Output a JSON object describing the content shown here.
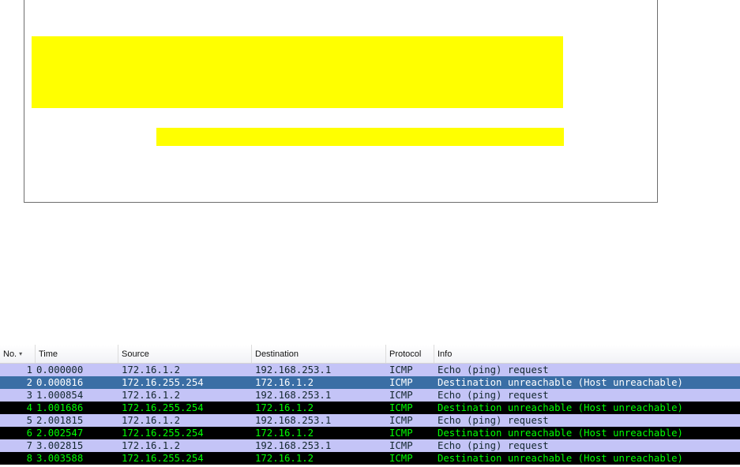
{
  "packet_list": {
    "columns": {
      "no": "No.",
      "time": "Time",
      "source": "Source",
      "destination": "Destination",
      "protocol": "Protocol",
      "info": "Info"
    },
    "sort_icon": "sort-descending-icon",
    "colors": {
      "request_bg": "#c4c4f7",
      "request_fg": "#12272e",
      "unreachable_bg": "#000000",
      "unreachable_fg": "#00ff00",
      "selected_bg": "#3a6ea5",
      "selected_fg": "#ffffff",
      "highlight": "#ffff00"
    },
    "rows": [
      {
        "no": "1",
        "time": "0.000000",
        "source": "172.16.1.2",
        "destination": "192.168.253.1",
        "protocol": "ICMP",
        "info": "Echo (ping) request",
        "kind": "request"
      },
      {
        "no": "2",
        "time": "0.000816",
        "source": "172.16.255.254",
        "destination": "172.16.1.2",
        "protocol": "ICMP",
        "info": "Destination unreachable (Host unreachable)",
        "kind": "selected"
      },
      {
        "no": "3",
        "time": "1.000854",
        "source": "172.16.1.2",
        "destination": "192.168.253.1",
        "protocol": "ICMP",
        "info": "Echo (ping) request",
        "kind": "request"
      },
      {
        "no": "4",
        "time": "1.001686",
        "source": "172.16.255.254",
        "destination": "172.16.1.2",
        "protocol": "ICMP",
        "info": "Destination unreachable (Host unreachable)",
        "kind": "unreachable"
      },
      {
        "no": "5",
        "time": "2.001815",
        "source": "172.16.1.2",
        "destination": "192.168.253.1",
        "protocol": "ICMP",
        "info": "Echo (ping) request",
        "kind": "request"
      },
      {
        "no": "6",
        "time": "2.002547",
        "source": "172.16.255.254",
        "destination": "172.16.1.2",
        "protocol": "ICMP",
        "info": "Destination unreachable (Host unreachable)",
        "kind": "unreachable"
      },
      {
        "no": "7",
        "time": "3.002815",
        "source": "172.16.1.2",
        "destination": "192.168.253.1",
        "protocol": "ICMP",
        "info": "Echo (ping) request",
        "kind": "request"
      },
      {
        "no": "8",
        "time": "3.003588",
        "source": "172.16.255.254",
        "destination": "172.16.1.2",
        "protocol": "ICMP",
        "info": "Destination unreachable (Host unreachable)",
        "kind": "unreachable"
      }
    ]
  }
}
